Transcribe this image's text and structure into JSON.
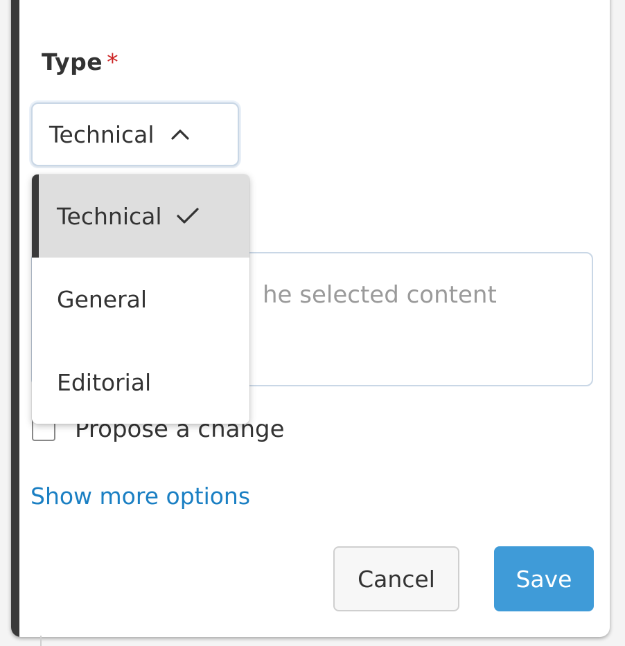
{
  "form": {
    "type_label": "Type",
    "required_marker": "*",
    "type_select": {
      "selected_value": "Technical",
      "options": [
        {
          "label": "Technical",
          "selected": true
        },
        {
          "label": "General",
          "selected": false
        },
        {
          "label": "Editorial",
          "selected": false
        }
      ]
    },
    "textarea_visible_placeholder": "he selected content",
    "propose_change_label": "Propose a change",
    "show_more_label": "Show more options",
    "cancel_label": "Cancel",
    "save_label": "Save"
  },
  "icons": {
    "select_toggle": "chevron-up-icon",
    "selected_option": "check-icon"
  },
  "colors": {
    "accent": "#3f9bd8",
    "link": "#1a7fc3",
    "required": "#cc2222",
    "selected_option_bg": "#dedede",
    "left_accent_bar": "#3a3a3a"
  }
}
